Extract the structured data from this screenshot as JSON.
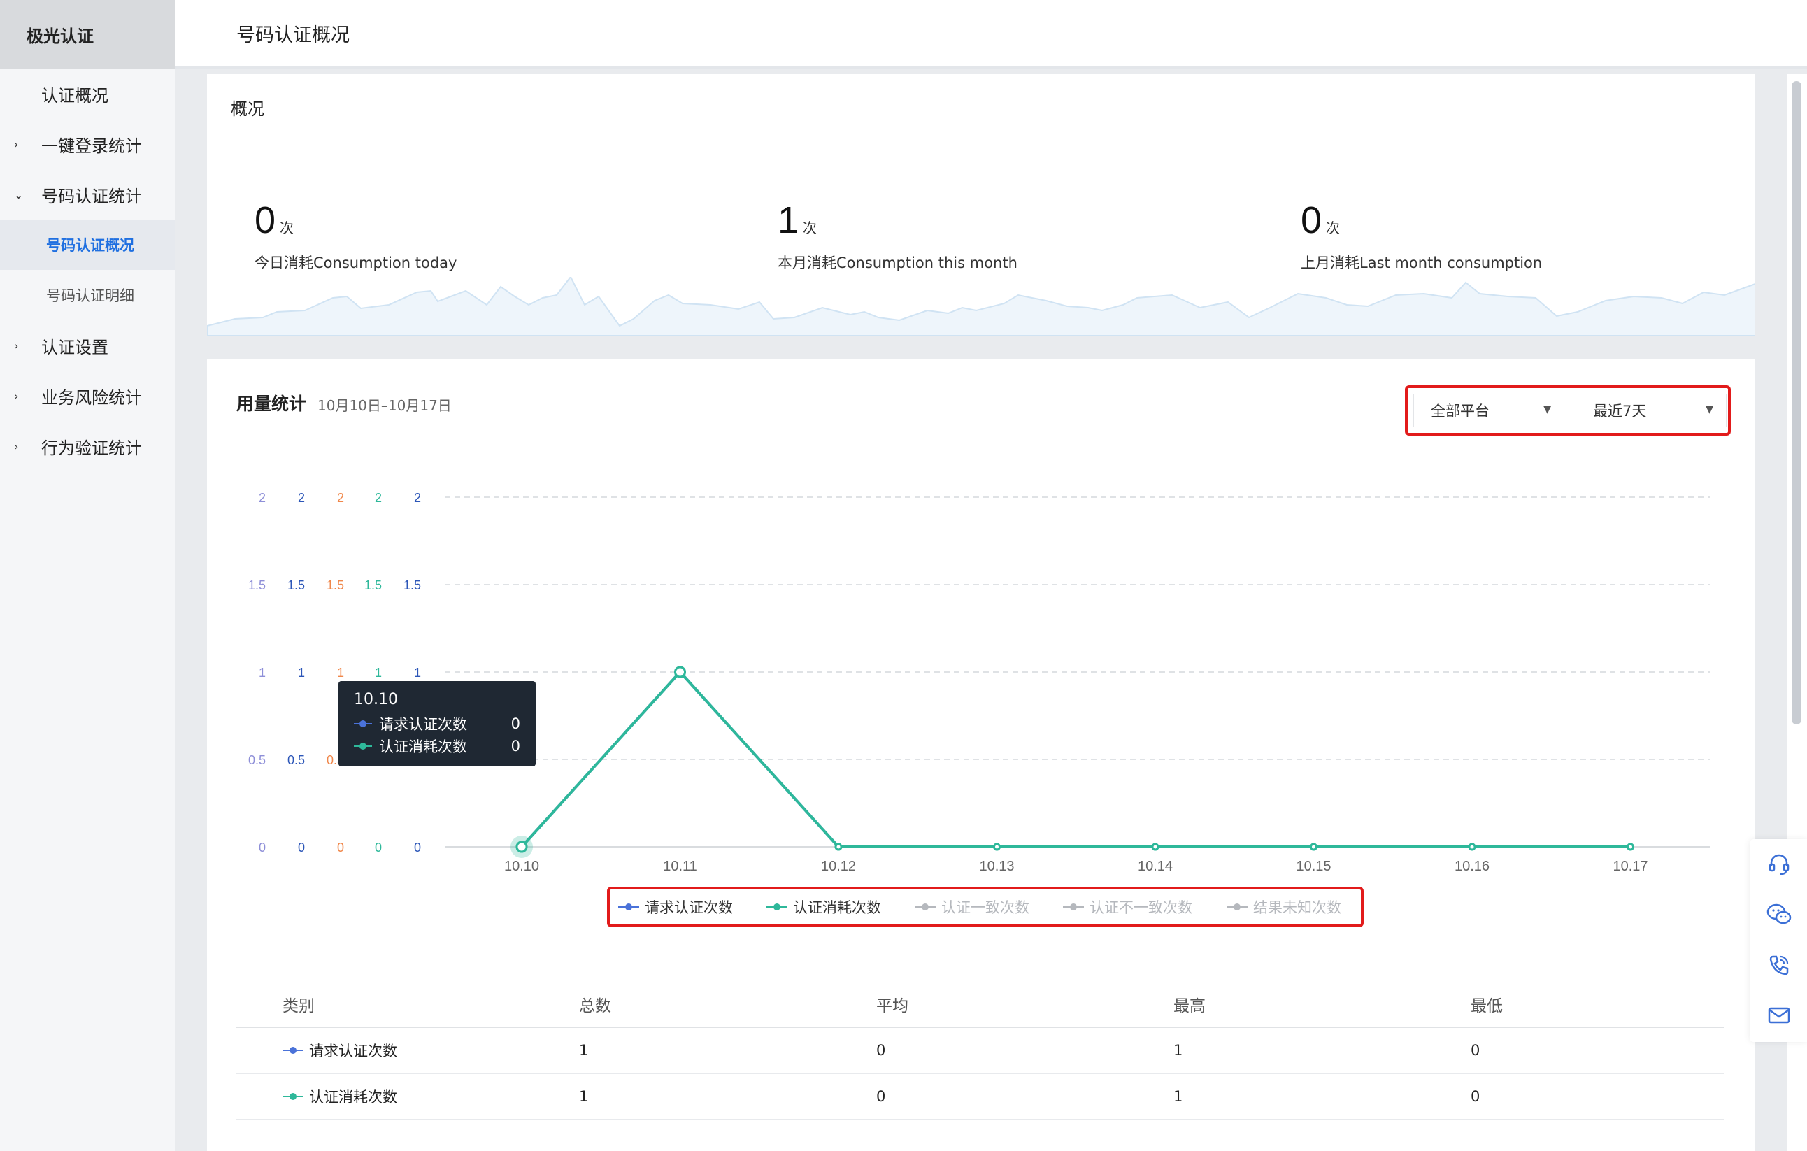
{
  "brand": "极光认证",
  "header": {
    "title": "号码认证概况"
  },
  "sidebar": {
    "items": [
      {
        "label": "认证概况",
        "arrow": ""
      },
      {
        "label": "一键登录统计",
        "arrow": "›"
      },
      {
        "label": "号码认证统计",
        "arrow": "⌄"
      },
      {
        "label": "号码认证概况",
        "arrow": ""
      },
      {
        "label": "号码认证明细",
        "arrow": ""
      },
      {
        "label": "认证设置",
        "arrow": "›"
      },
      {
        "label": "业务风险统计",
        "arrow": "›"
      },
      {
        "label": "行为验证统计",
        "arrow": "›"
      }
    ]
  },
  "overview": {
    "title": "概况",
    "stats": [
      {
        "value": "0",
        "unit": "次",
        "label": "今日消耗Consumption today"
      },
      {
        "value": "1",
        "unit": "次",
        "label": "本月消耗Consumption this month"
      },
      {
        "value": "0",
        "unit": "次",
        "label": "上月消耗Last month consumption"
      }
    ]
  },
  "usage": {
    "title": "用量统计",
    "date_range": "10月10日–10月17日",
    "platform_select": "全部平台",
    "period_select": "最近7天"
  },
  "colors": {
    "request": "#4a72d9",
    "consume": "#2eb89a",
    "orange": "#f0874a",
    "purple": "#8e8fd8",
    "disabled": "#b5b8bd"
  },
  "chart_data": {
    "type": "line",
    "categories": [
      "10.10",
      "10.11",
      "10.12",
      "10.13",
      "10.14",
      "10.15",
      "10.16",
      "10.17"
    ],
    "ylim": [
      0,
      2
    ],
    "y_ticks": [
      "0",
      "0.5",
      "1",
      "1.5",
      "2"
    ],
    "series": [
      {
        "name": "请求认证次数",
        "values": [
          0,
          1,
          0,
          0,
          0,
          0,
          0,
          0
        ],
        "active": true
      },
      {
        "name": "认证消耗次数",
        "values": [
          0,
          1,
          0,
          0,
          0,
          0,
          0,
          0
        ],
        "active": true
      },
      {
        "name": "认证一致次数",
        "values": [],
        "active": false
      },
      {
        "name": "认证不一致次数",
        "values": [],
        "active": false
      },
      {
        "name": "结果未知次数",
        "values": [],
        "active": false
      }
    ],
    "grid": true,
    "legend": "bottom"
  },
  "tooltip": {
    "title": "10.10",
    "rows": [
      {
        "label": "请求认证次数",
        "value": "0"
      },
      {
        "label": "认证消耗次数",
        "value": "0"
      }
    ]
  },
  "table": {
    "headers": [
      "类别",
      "总数",
      "平均",
      "最高",
      "最低"
    ],
    "rows": [
      {
        "category": "请求认证次数",
        "total": "1",
        "avg": "0",
        "max": "1",
        "min": "0"
      },
      {
        "category": "认证消耗次数",
        "total": "1",
        "avg": "0",
        "max": "1",
        "min": "0"
      }
    ]
  },
  "float_panel": {
    "icons": [
      "headset-icon",
      "wechat-icon",
      "phone-icon",
      "mail-icon"
    ]
  }
}
